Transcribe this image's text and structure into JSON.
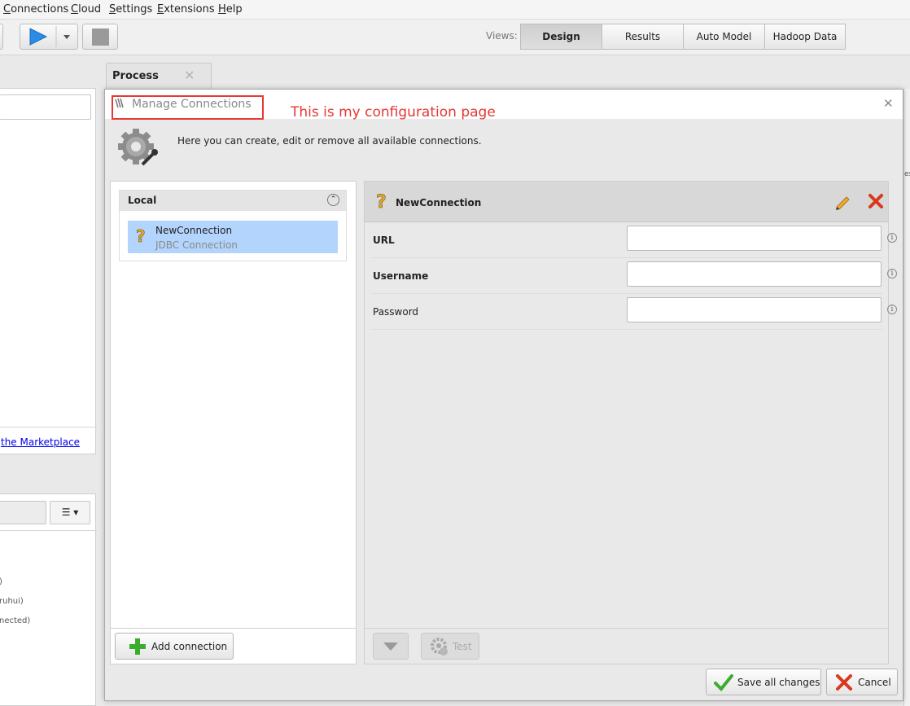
{
  "menu": [
    {
      "label": "Connections",
      "underline": "C",
      "rest": "onnections"
    },
    {
      "label": "Cloud",
      "underline": "C",
      "rest": "loud"
    },
    {
      "label": "Settings",
      "underline": "S",
      "rest": "ettings"
    },
    {
      "label": "Extensions",
      "underline": "E",
      "rest": "xtensions"
    },
    {
      "label": "Help",
      "underline": "H",
      "rest": "elp"
    }
  ],
  "toolbar": {
    "views_label": "Views:",
    "views": [
      "Design",
      "Results",
      "Auto Model",
      "Hadoop Data"
    ],
    "active_view": "Design"
  },
  "background": {
    "marketplace_link": "the Marketplace",
    "list_fragments": [
      ")",
      "ruhui)",
      "nected)"
    ],
    "right_fragment": "es"
  },
  "process_tab": {
    "label": "Process"
  },
  "dialog": {
    "title": "Manage Connections",
    "annotation": "This is my configuration page",
    "description": "Here you can create, edit or remove all available connections.",
    "left_panel": {
      "group_label": "Local",
      "connections": [
        {
          "name": "NewConnection",
          "type": "JDBC Connection",
          "selected": true
        }
      ],
      "add_button": "Add connection"
    },
    "detail": {
      "name": "NewConnection",
      "fields": [
        {
          "label": "URL",
          "value": "",
          "bold": true
        },
        {
          "label": "Username",
          "value": "",
          "bold": true
        },
        {
          "label": "Password",
          "value": "",
          "bold": false
        }
      ],
      "test_button": "Test"
    },
    "save_button": "Save all changes",
    "cancel_button": "Cancel"
  },
  "colors": {
    "selection": "#b3d4fc",
    "annotation_red": "#e53935",
    "play_blue": "#2a8ce6",
    "add_green": "#3cac2e",
    "delete_red": "#d9381e",
    "warn_yellow": "#e3a62a"
  }
}
